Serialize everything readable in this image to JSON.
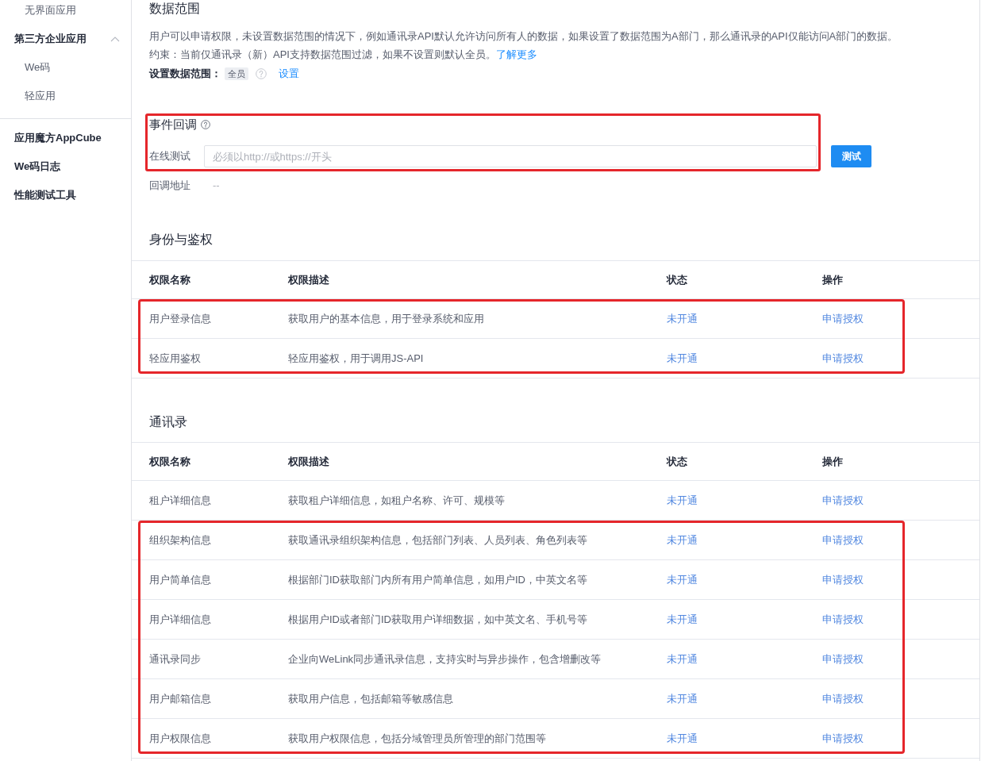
{
  "sidebar": {
    "sections": [
      {
        "items": [
          {
            "label": "无界面应用",
            "kind": "subitem"
          },
          {
            "label": "第三方企业应用",
            "kind": "group",
            "expanded": true
          },
          {
            "label": "We码",
            "kind": "subitem"
          },
          {
            "label": "轻应用",
            "kind": "subitem"
          }
        ]
      },
      {
        "items": [
          {
            "label": "应用魔方AppCube",
            "kind": "item"
          },
          {
            "label": "We码日志",
            "kind": "item"
          },
          {
            "label": "性能测试工具",
            "kind": "item"
          }
        ]
      }
    ]
  },
  "data_scope": {
    "title": "数据范围",
    "description": "用户可以申请权限，未设置数据范围的情况下，例如通讯录API默认允许访问所有人的数据，如果设置了数据范围为A部门，那么通讯录的API仅能访问A部门的数据。",
    "constraint": "约束：当前仅通讯录（新）API支持数据范围过滤，如果不设置则默认全员。",
    "learn_more_link": "了解更多",
    "setting_label": "设置数据范围：",
    "setting_value": "全员",
    "setting_link": "设置"
  },
  "event_callback": {
    "title": "事件回调",
    "highlighted": true,
    "test_label": "在线测试",
    "test_input": {
      "placeholder": "必须以http://或https://开头"
    },
    "test_button": "测试",
    "address_label": "回调地址",
    "address_value": "--"
  },
  "permission_tables": [
    {
      "title": "身份与鉴权",
      "columns": [
        "权限名称",
        "权限描述",
        "状态",
        "操作"
      ],
      "rows": [
        {
          "name": "用户登录信息",
          "description": "获取用户的基本信息，用于登录系统和应用",
          "status": "未开通",
          "action": "申请授权",
          "highlighted": true
        },
        {
          "name": "轻应用鉴权",
          "description": "轻应用鉴权，用于调用JS-API",
          "status": "未开通",
          "action": "申请授权",
          "highlighted": true
        }
      ]
    },
    {
      "title": "通讯录",
      "columns": [
        "权限名称",
        "权限描述",
        "状态",
        "操作"
      ],
      "rows": [
        {
          "name": "租户详细信息",
          "description": "获取租户详细信息，如租户名称、许可、规模等",
          "status": "未开通",
          "action": "申请授权",
          "highlighted": false
        },
        {
          "name": "组织架构信息",
          "description": "获取通讯录组织架构信息，包括部门列表、人员列表、角色列表等",
          "status": "未开通",
          "action": "申请授权",
          "highlighted": true
        },
        {
          "name": "用户简单信息",
          "description": "根据部门ID获取部门内所有用户简单信息，如用户ID，中英文名等",
          "status": "未开通",
          "action": "申请授权",
          "highlighted": true
        },
        {
          "name": "用户详细信息",
          "description": "根据用户ID或者部门ID获取用户详细数据，如中英文名、手机号等",
          "status": "未开通",
          "action": "申请授权",
          "highlighted": true
        },
        {
          "name": "通讯录同步",
          "description": "企业向WeLink同步通讯录信息，支持实时与异步操作，包含增删改等",
          "status": "未开通",
          "action": "申请授权",
          "highlighted": true
        },
        {
          "name": "用户邮箱信息",
          "description": "获取用户信息，包括邮箱等敏感信息",
          "status": "未开通",
          "action": "申请授权",
          "highlighted": true
        },
        {
          "name": "用户权限信息",
          "description": "获取用户权限信息，包括分域管理员所管理的部门范围等",
          "status": "未开通",
          "action": "申请授权",
          "highlighted": true
        }
      ]
    }
  ]
}
